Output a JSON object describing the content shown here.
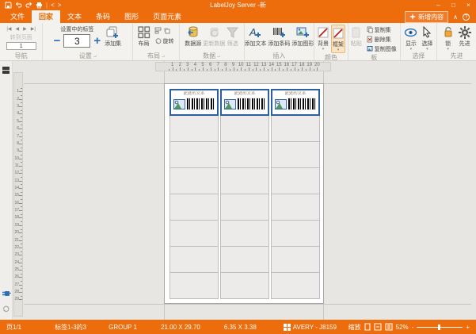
{
  "window": {
    "title": "LabelJoy Server -新",
    "controls": {
      "minimize": "–",
      "maximize": "□",
      "close": "×"
    }
  },
  "quick_access": {
    "back": "<",
    "forward": ">"
  },
  "tabs": {
    "items": [
      {
        "label": "文件",
        "active": false
      },
      {
        "label": "回家",
        "active": true
      },
      {
        "label": "文本",
        "active": false
      },
      {
        "label": "条码",
        "active": false
      },
      {
        "label": "图形",
        "active": false
      },
      {
        "label": "页面元素",
        "active": false
      }
    ],
    "new_content_label": "新增内容",
    "collapse_glyph": "∧",
    "help_glyph": "?"
  },
  "ribbon": {
    "navigation": {
      "label": "导航",
      "goto_label": "转到页面",
      "page_value": "1",
      "first": "|◀",
      "prev": "◀",
      "next": "▶",
      "last": "▶|"
    },
    "settings": {
      "label": "设置",
      "field_label": "设置中的标签",
      "count_value": "3",
      "minus": "−",
      "plus": "+",
      "add_set": "添加集"
    },
    "layout": {
      "label": "布局",
      "layout_btn": "布局",
      "rotate": "旋转"
    },
    "data": {
      "label": "数据",
      "source": "数据源",
      "refresh": "更新数据",
      "filter": "筛选"
    },
    "insert": {
      "label": "插入",
      "add_text": "添加文本",
      "add_barcode": "添加条码",
      "add_image": "添加图形"
    },
    "colors": {
      "label": "颜色",
      "background": "背景",
      "frame": "框架"
    },
    "clipboard": {
      "label": "板",
      "paste": "粘贴",
      "copy_set": "复制集",
      "delete_set": "删除集",
      "copy_image": "复制图像"
    },
    "selection": {
      "label": "选择",
      "show": "显示",
      "select": "选择"
    },
    "advanced": {
      "label": "先进",
      "lock": "锁",
      "advanced_btn": "先进"
    }
  },
  "canvas": {
    "h_ruler": {
      "start": 1,
      "end": 20
    },
    "v_ruler": {
      "start": 1,
      "end": 29
    },
    "page": {
      "cols": 3,
      "rows": 8,
      "filled_labels": 3,
      "label_text": "此处的文本"
    }
  },
  "status_bar": {
    "page": "页1/1",
    "labels": "标签1-3的3",
    "group": "GROUP 1",
    "page_size": "21.00 X 29.70",
    "label_size": "6.35 X 3.38",
    "template": "AVERY - J8159",
    "zoom_label": "缩放",
    "zoom_percent": "52%",
    "zoom_minus": "-",
    "zoom_plus": "+"
  },
  "colors": {
    "accent_orange": "#ed6c0c",
    "selection_blue": "#2d5f9e",
    "ribbon_bg": "#f4f2ef",
    "canvas_bg": "#e8e6e3"
  }
}
